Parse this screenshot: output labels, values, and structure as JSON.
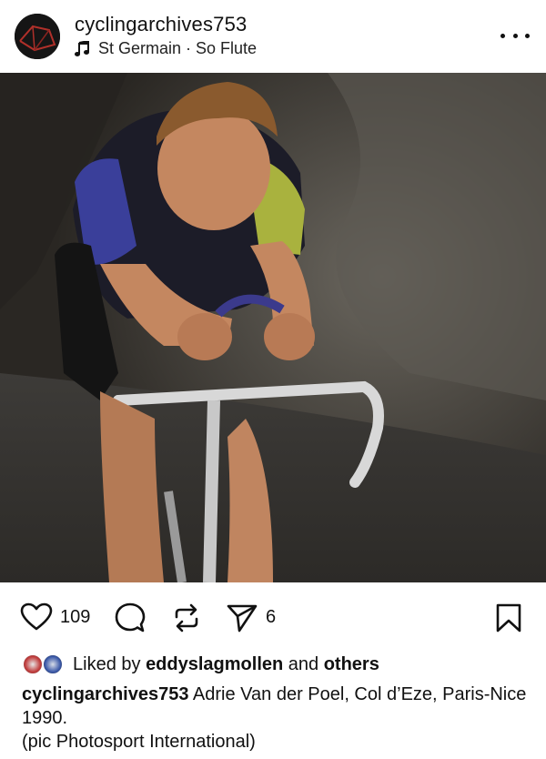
{
  "header": {
    "username": "cyclingarchives753",
    "music_artist": "St Germain",
    "music_separator": " · ",
    "music_track": "So Flute",
    "music_icon": "music-note-icon",
    "more_icon": "more-horizontal-icon"
  },
  "media": {
    "mute_icon": "speaker-muted-icon"
  },
  "actions": {
    "like_icon": "heart-icon",
    "like_count": "109",
    "comment_icon": "comment-bubble-icon",
    "repost_icon": "repost-icon",
    "share_icon": "paper-plane-icon",
    "share_count": "6",
    "save_icon": "bookmark-icon"
  },
  "likes": {
    "prefix": "Liked by ",
    "user": "eddyslagmollen",
    "middle": " and ",
    "others": "others"
  },
  "caption": {
    "user": "cyclingarchives753",
    "text": " Adrie Van der Poel, Col d’Eze, Paris-Nice 1990.",
    "credit": "(pic Photosport International)"
  },
  "colors": {
    "text": "#111111",
    "background": "#ffffff"
  }
}
